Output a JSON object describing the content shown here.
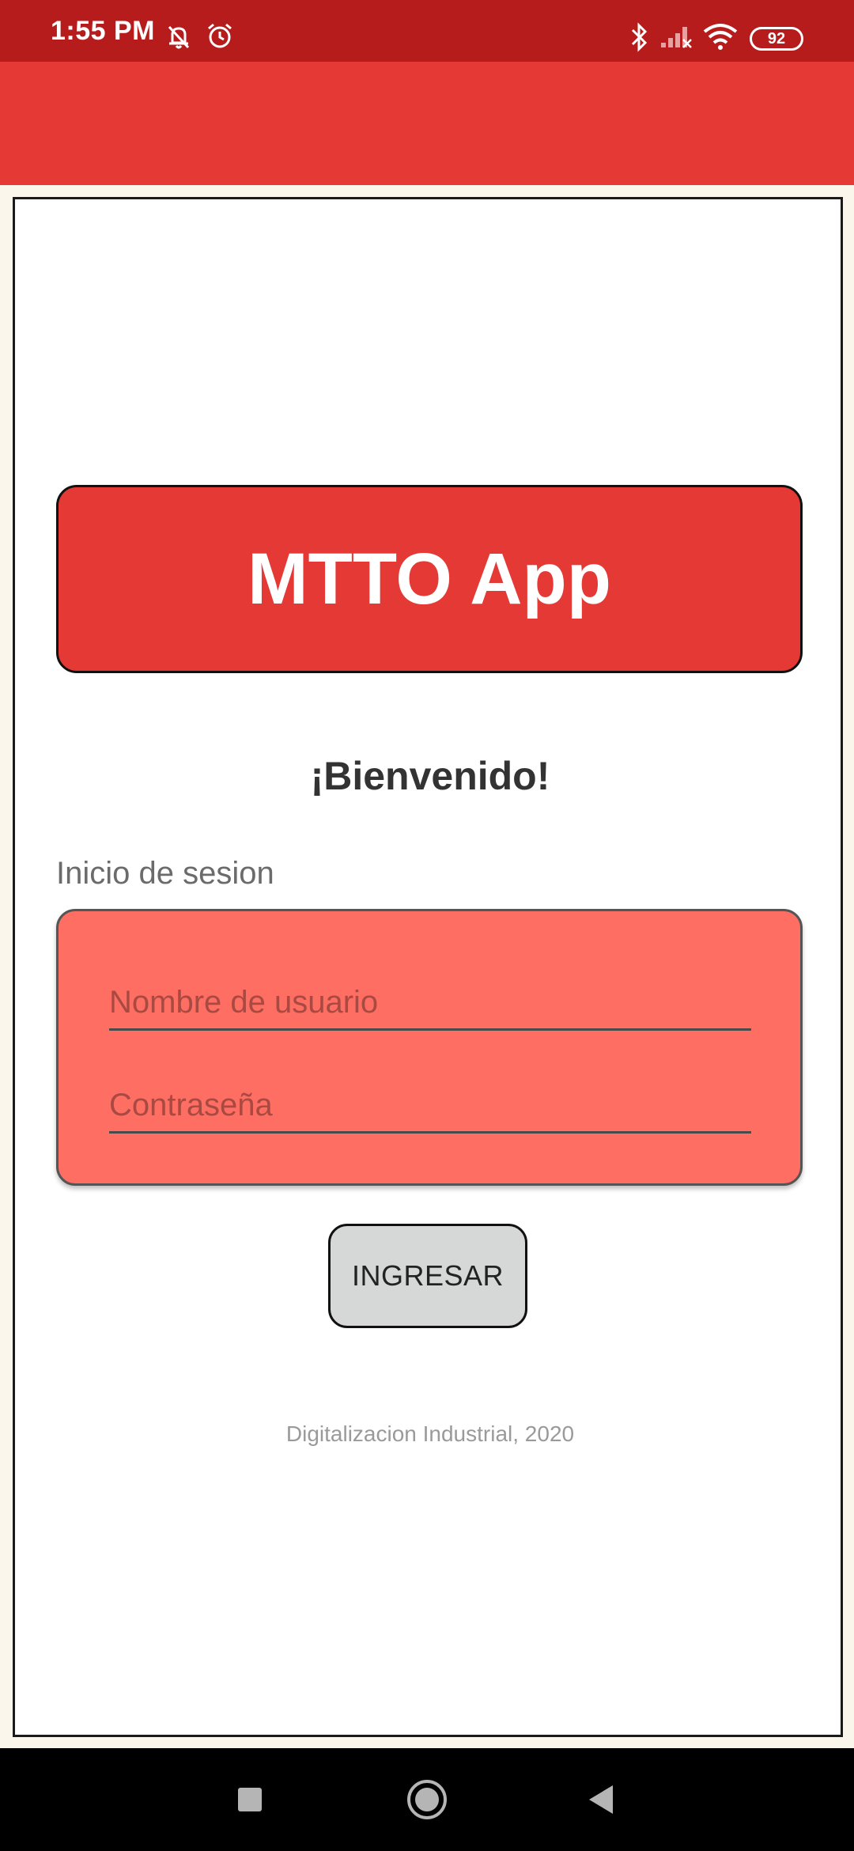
{
  "status_bar": {
    "time": "1:55 PM",
    "battery": "92",
    "icons": [
      "mute-bell-icon",
      "alarm-icon",
      "bluetooth-icon",
      "signal-icon",
      "wifi-icon",
      "battery-icon"
    ]
  },
  "colors": {
    "status_bar": "#b71c1c",
    "app_bar": "#e53935",
    "form_card": "#ff6e63",
    "button": "#d6d8d7",
    "page_bg": "#fbf6ec"
  },
  "header": {
    "title": "MTTO App"
  },
  "main": {
    "welcome": "¡Bienvenido!",
    "section_label": "Inicio de sesion",
    "username_placeholder": "Nombre de usuario",
    "password_placeholder": "Contraseña",
    "login_button": "INGRESAR",
    "footer": "Digitalizacion Industrial, 2020"
  },
  "nav": {
    "icons": [
      "recents-icon",
      "home-icon",
      "back-icon"
    ]
  }
}
